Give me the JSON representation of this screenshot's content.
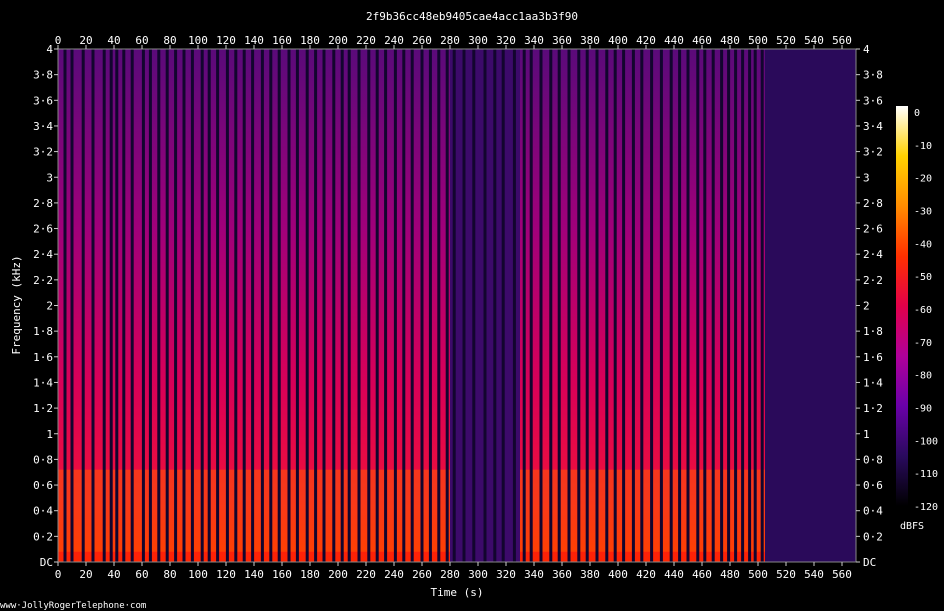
{
  "chart_data": {
    "type": "heatmap",
    "title": "2f9b36cc48eb9405cae4acc1aa3b3f90",
    "xlabel": "Time (s)",
    "ylabel": "Frequency (kHz)",
    "xlim": [
      0,
      570
    ],
    "ylim": [
      0,
      4
    ],
    "x_ticks": [
      "0",
      "20",
      "40",
      "60",
      "80",
      "100",
      "120",
      "140",
      "160",
      "180",
      "200",
      "220",
      "240",
      "260",
      "280",
      "300",
      "320",
      "340",
      "360",
      "380",
      "400",
      "420",
      "440",
      "460",
      "480",
      "500",
      "520",
      "540",
      "560"
    ],
    "y_ticks": [
      "DC",
      "0·2",
      "0·4",
      "0·6",
      "0·8",
      "1",
      "1·2",
      "1·4",
      "1·6",
      "1·8",
      "2",
      "2·2",
      "2·4",
      "2·6",
      "2·8",
      "3",
      "3·2",
      "3·4",
      "3·6",
      "3·8",
      "4"
    ],
    "colorbar": {
      "label": "dBFS",
      "range": [
        -120,
        0
      ],
      "ticks": [
        "0",
        "-10",
        "-20",
        "-30",
        "-40",
        "-50",
        "-60",
        "-70",
        "-80",
        "-90",
        "-100",
        "-110",
        "-120"
      ],
      "colors": [
        "#000000",
        "#2a0a5e",
        "#6a00a8",
        "#b0009a",
        "#e2004a",
        "#ff3000",
        "#ff8c00",
        "#ffd200",
        "#ffffff"
      ]
    },
    "segments": [
      {
        "start": 0,
        "end": 280,
        "level_db": -55
      },
      {
        "start": 280,
        "end": 330,
        "level_db": -85
      },
      {
        "start": 330,
        "end": 505,
        "level_db": -55
      },
      {
        "start": 505,
        "end": 570,
        "level_db": -100
      }
    ],
    "silence_gaps_s": [
      5,
      10,
      18,
      25,
      33,
      38,
      42,
      47,
      53,
      61,
      66,
      72,
      78,
      84,
      90,
      96,
      103,
      108,
      114,
      121,
      127,
      133,
      139,
      146,
      152,
      158,
      165,
      171,
      178,
      184,
      190,
      197,
      203,
      208,
      215,
      222,
      228,
      234,
      241,
      247,
      253,
      260,
      266,
      272,
      278,
      283,
      290,
      297,
      305,
      312,
      318,
      326,
      333,
      338,
      345,
      352,
      358,
      365,
      372,
      378,
      385,
      392,
      398,
      404,
      411,
      417,
      424,
      431,
      438,
      444,
      450,
      457,
      462,
      468,
      474,
      479,
      484,
      489,
      494,
      498,
      503
    ]
  },
  "footer": {
    "watermark": "www·JollyRogerTelephone·com"
  }
}
